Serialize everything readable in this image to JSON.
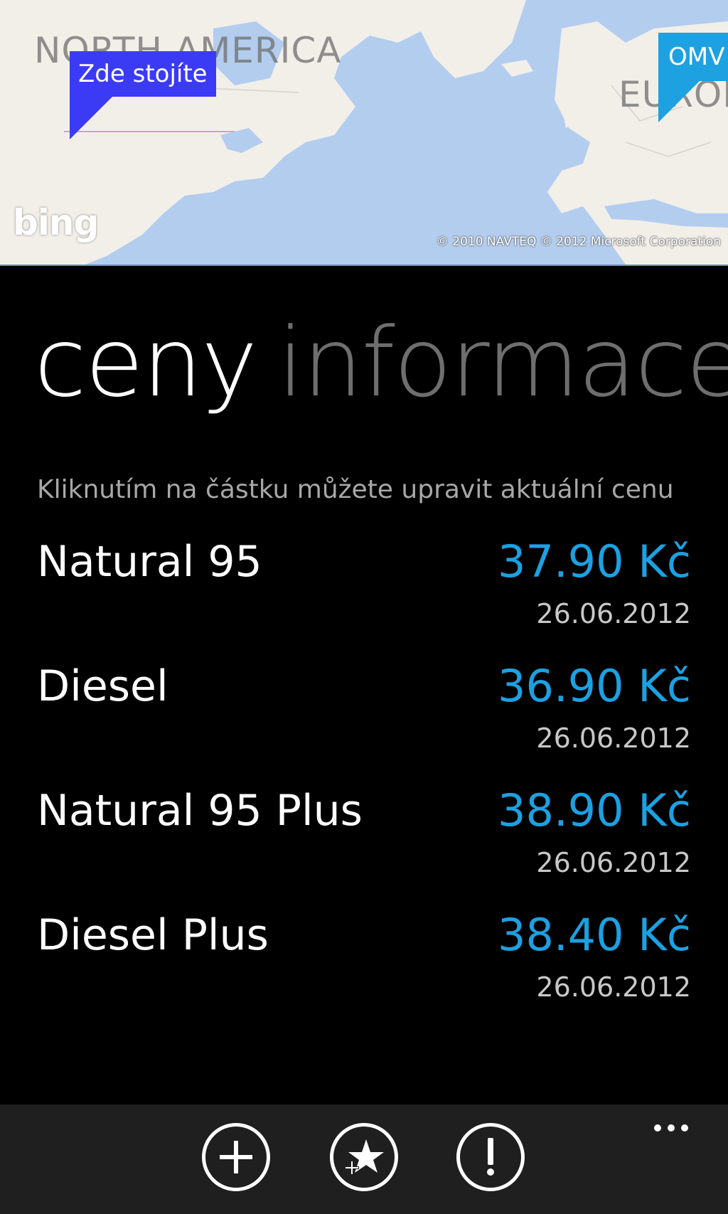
{
  "map": {
    "region_north_america": "NORTH AMERICA",
    "region_europe": "EUROPE",
    "pin_current_location": "Zde stojíte",
    "pin_station": "OMV",
    "provider_logo": "bing",
    "copyright": "© 2010 NAVTEQ © 2012 Microsoft Corporation",
    "colors": {
      "water": "#b3cdef",
      "land": "#f2efe9",
      "pin_current": "#3b3bf6",
      "pin_station": "#1ea1e1"
    }
  },
  "pivot": {
    "active": "ceny",
    "inactive": "informace"
  },
  "hint": "Kliknutím na částku můžete upravit aktuální cenu",
  "fuels": [
    {
      "name": "Natural 95",
      "price": "37.90 Kč",
      "date": "26.06.2012"
    },
    {
      "name": "Diesel",
      "price": "36.90 Kč",
      "date": "26.06.2012"
    },
    {
      "name": "Natural 95 Plus",
      "price": "38.90 Kč",
      "date": "26.06.2012"
    },
    {
      "name": "Diesel Plus",
      "price": "38.40 Kč",
      "date": "26.06.2012"
    }
  ],
  "appbar": {
    "buttons": [
      {
        "icon": "add-icon"
      },
      {
        "icon": "favorite-star-icon"
      },
      {
        "icon": "alert-exclamation-icon"
      }
    ],
    "more_icon": "ellipsis-icon"
  },
  "theme": {
    "accent": "#1ba1e2",
    "background": "#000000",
    "appbar": "#1f1f1f"
  }
}
